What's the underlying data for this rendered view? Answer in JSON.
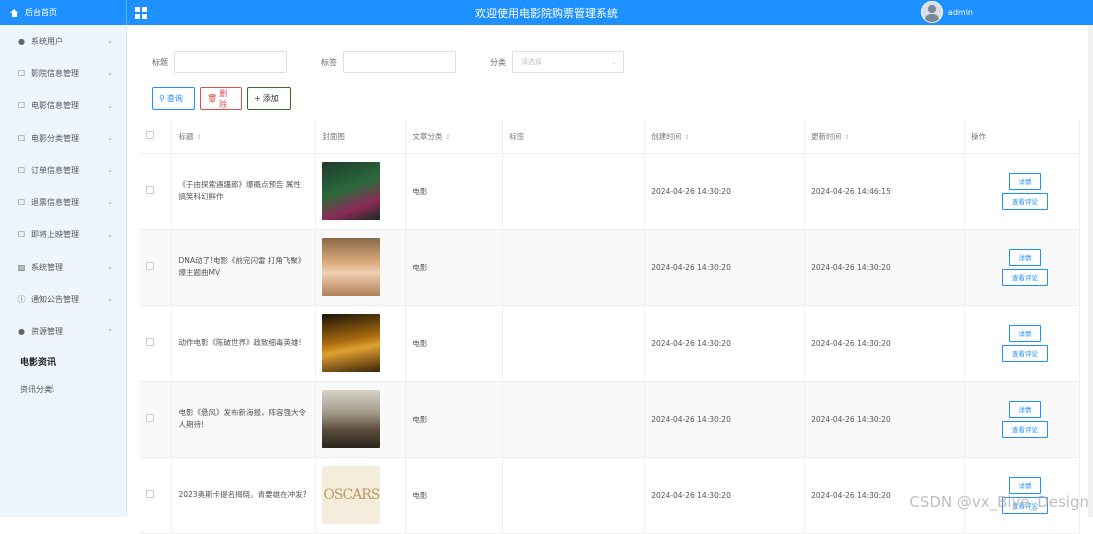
{
  "header": {
    "brand_label": "后台首页",
    "title": "欢迎使用电影院购票管理系统",
    "username": "admin"
  },
  "sidebar": {
    "items": [
      {
        "label": "系统用户",
        "icon": "user-icon"
      },
      {
        "label": "影院信息管理",
        "icon": "edit-icon"
      },
      {
        "label": "电影信息管理",
        "icon": "edit-icon"
      },
      {
        "label": "电影分类管理",
        "icon": "edit-icon"
      },
      {
        "label": "订单信息管理",
        "icon": "edit-icon"
      },
      {
        "label": "退票信息管理",
        "icon": "edit-icon"
      },
      {
        "label": "即将上映管理",
        "icon": "edit-icon"
      },
      {
        "label": "系统管理",
        "icon": "picture-icon"
      },
      {
        "label": "通知公告管理",
        "icon": "info-icon"
      },
      {
        "label": "资源管理",
        "icon": "location-icon"
      }
    ],
    "sub_items": [
      {
        "label": "电影资讯",
        "active": true
      },
      {
        "label": "资讯分类",
        "active": false
      }
    ]
  },
  "filters": {
    "title_label": "标题",
    "tag_label": "标签",
    "category_label": "分类",
    "category_placeholder": "请选择"
  },
  "buttons": {
    "query": "查询",
    "delete": "删除",
    "add": "添加"
  },
  "table": {
    "headers": [
      "标题",
      "封面图",
      "文章分类",
      "标签",
      "创建时间",
      "更新时间",
      "操作"
    ],
    "rows": [
      {
        "title": "《于由探索遇疆郎》爆概点预告 属性搞笑科幻鲜作",
        "category": "电影",
        "tag": "",
        "created": "2024-04-26 14:30:20",
        "updated": "2024-04-26 14:46:15"
      },
      {
        "title": "DNA动了!电影《前完闪雷 打角飞聚》爆主题曲MV",
        "category": "电影",
        "tag": "",
        "created": "2024-04-26 14:30:20",
        "updated": "2024-04-26 14:30:20"
      },
      {
        "title": "动作电影《陈破世界》政致细毒英雄!",
        "category": "电影",
        "tag": "",
        "created": "2024-04-26 14:30:20",
        "updated": "2024-04-26 14:30:20"
      },
      {
        "title": "电影《悬风》发布新海报，阵容强大令人期待!",
        "category": "电影",
        "tag": "",
        "created": "2024-04-26 14:30:20",
        "updated": "2024-04-26 14:30:20"
      },
      {
        "title": "2023奥斯卡提名揭晓，青要雄在冲发?",
        "category": "电影",
        "tag": "",
        "created": "2024-04-26 14:30:20",
        "updated": "2024-04-26 14:30:20"
      }
    ],
    "op_detail": "详情",
    "op_review": "查看评论",
    "thumb_e_text": "OSCARS"
  },
  "watermark": "CSDN @vx_Biye_Design",
  "colors": {
    "accent": "#1e90ff",
    "sidebar_bg": "#eef5fd",
    "danger": "#e05050"
  }
}
